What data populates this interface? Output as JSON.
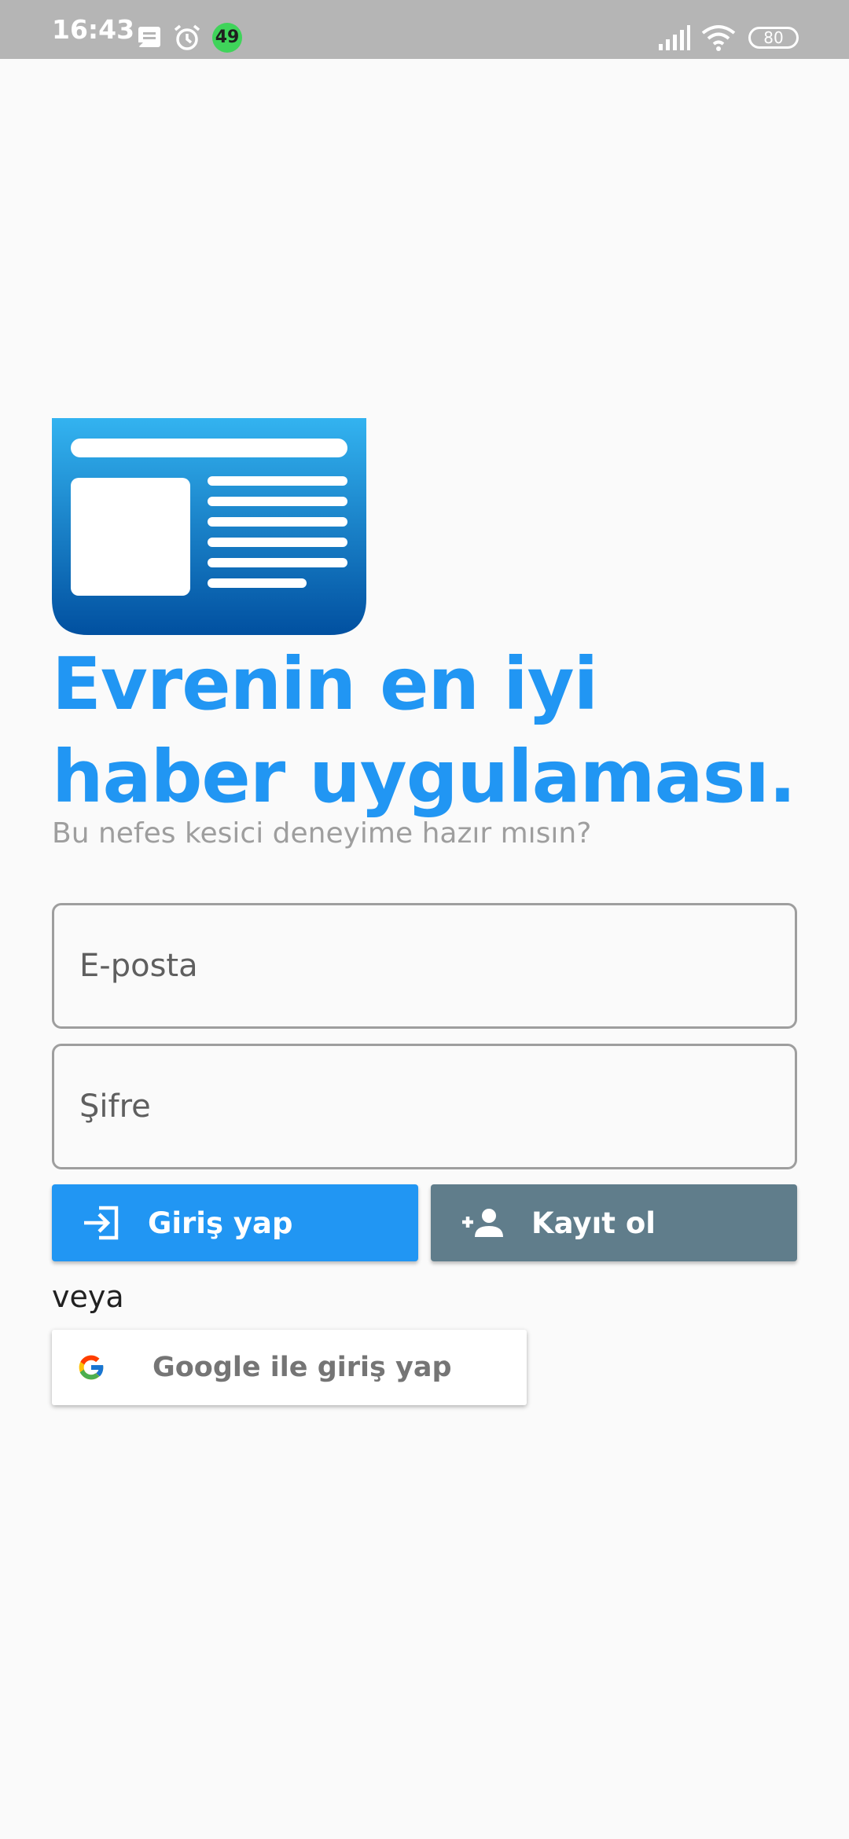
{
  "status_bar": {
    "time": "16:43",
    "notification_count": "49",
    "battery": "80",
    "icons": [
      "message-icon",
      "alarm-icon",
      "signal-icon",
      "wifi-icon",
      "battery-icon"
    ]
  },
  "hero": {
    "logo_icon": "newspaper-icon",
    "headline": "Evrenin en iyi haber uygulaması.",
    "subline": "Bu nefes kesici deneyime hazır mısın?"
  },
  "form": {
    "email_placeholder": "E-posta",
    "password_placeholder": "Şifre"
  },
  "actions": {
    "login_label": "Giriş yap",
    "login_icon": "login-icon",
    "register_label": "Kayıt ol",
    "register_icon": "person-add-icon",
    "or_label": "veya",
    "google_label": "Google ile giriş yap",
    "google_icon": "google-icon"
  },
  "colors": {
    "primary": "#2196f3",
    "secondary": "#607d8b",
    "background": "#fafafa",
    "status_bar": "#b5b5b5"
  }
}
